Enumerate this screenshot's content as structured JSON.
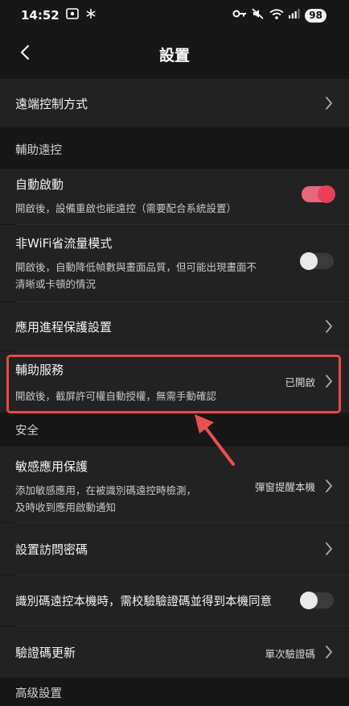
{
  "status": {
    "time": "14:52",
    "battery": "98",
    "left_icons": [
      "screenshot-icon",
      "snowflake-icon"
    ],
    "right_icons": [
      "key-icon",
      "mute-icon",
      "wifi-icon",
      "signal-icon"
    ]
  },
  "header": {
    "title": "設置"
  },
  "rows": {
    "remote_control": {
      "label": "遠端控制方式"
    },
    "auto_start": {
      "label": "自動啟動",
      "desc": "開啟後，設備重啟也能遠控（需要配合系統設置）",
      "enabled": true
    },
    "non_wifi": {
      "label": "非WiFi省流量模式",
      "desc_line1": "開啟後，自動降低幀數與畫面品質，但可能出現畫面不",
      "desc_line2": "清晰或卡頓的情況",
      "enabled": false
    },
    "process_protect": {
      "label": "應用進程保護設置"
    },
    "accessibility": {
      "label": "輔助服務",
      "desc": "開啟後，截屏許可權自動授權，無需手動確認",
      "value": "已開啟"
    },
    "sensitive_apps": {
      "label": "敏感應用保護",
      "desc_line1": "添加敏感應用，在被識別碼遠控時檢測，",
      "desc_line2": "及時收到應用啟動通知",
      "value": "彈窗提醒本機"
    },
    "access_password": {
      "label": "設置訪問密碼"
    },
    "code_verify": {
      "label": "識別碼遠控本機時，需校驗驗證碼並得到本機同意",
      "enabled": false
    },
    "verify_update": {
      "label": "驗證碼更新",
      "value": "單次驗證碼"
    }
  },
  "sections": {
    "assist": "輔助遠控",
    "security": "安全",
    "advanced": "高级設置"
  },
  "colors": {
    "background": "#171717",
    "row_background": "#222222",
    "toggle_on": "#e83f5b",
    "highlight": "#e64a4a"
  }
}
